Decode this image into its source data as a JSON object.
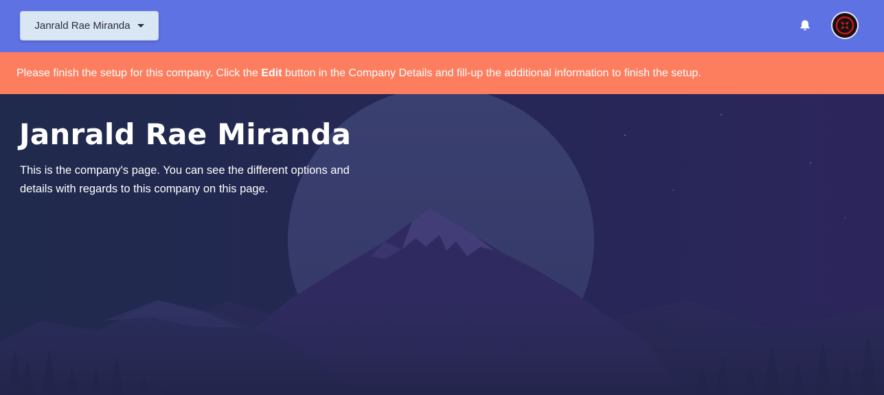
{
  "navbar": {
    "company_dropdown_label": "Janrald Rae Miranda",
    "bell_icon": "bell-icon",
    "avatar_icon": "avatar-icon"
  },
  "alert": {
    "text_before": "Please finish the setup for this company. Click the ",
    "text_bold": "Edit",
    "text_after": " button in the Company Details and fill-up the additional information to finish the setup.",
    "color": "#fd7e5f"
  },
  "hero": {
    "title": "Janrald Rae Miranda",
    "description": "This is the company's page. You can see the different options and details with regards to this company on this page."
  },
  "colors": {
    "navbar": "#5e72e4",
    "hero_background": "#262750",
    "dropdown_background": "#d9e6f3"
  }
}
